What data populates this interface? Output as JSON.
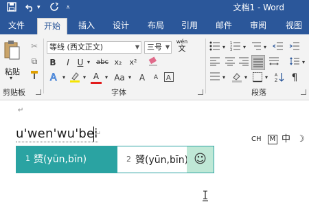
{
  "titlebar": {
    "save_icon": "save-icon",
    "undo_icon": "undo-icon",
    "redo_icon": "redo-icon",
    "customize_icon": "chevron-down-icon",
    "title": "文档1 - Word"
  },
  "tabs": [
    {
      "label": "文件"
    },
    {
      "label": "开始"
    },
    {
      "label": "插入"
    },
    {
      "label": "设计"
    },
    {
      "label": "布局"
    },
    {
      "label": "引用"
    },
    {
      "label": "邮件"
    },
    {
      "label": "审阅"
    },
    {
      "label": "视图"
    }
  ],
  "ribbon": {
    "clipboard": {
      "paste_label": "粘贴",
      "group_label": "剪贴板"
    },
    "font": {
      "font_name": "等线 (西文正文)",
      "font_size": "三号",
      "wen_label": "wén",
      "wen_char": "文",
      "bold": "B",
      "italic": "I",
      "underline": "U",
      "strike": "abc",
      "subscript": "x₂",
      "superscript": "x²",
      "font_color": "A",
      "case": "Aa",
      "grow": "A",
      "shrink": "A",
      "group_label": "字体"
    },
    "paragraph": {
      "group_label": "段落"
    }
  },
  "document": {
    "paragraph_mark": "↵",
    "pinyin_text": "u'wen'wu'bei",
    "end_mark": "↵"
  },
  "ime_bar": {
    "ch": "CH",
    "m": "M",
    "zhong": "中",
    "moon": "☽"
  },
  "candidates": [
    {
      "num": "1",
      "text": "赟(yūn,bīn)"
    },
    {
      "num": "2",
      "text": "贇(yūn,bīn)"
    }
  ],
  "emoji": "☺",
  "colors": {
    "brand": "#2b579a",
    "candidate_bar": "#2aa3a2",
    "emoji_bg": "#bfe8d6"
  }
}
